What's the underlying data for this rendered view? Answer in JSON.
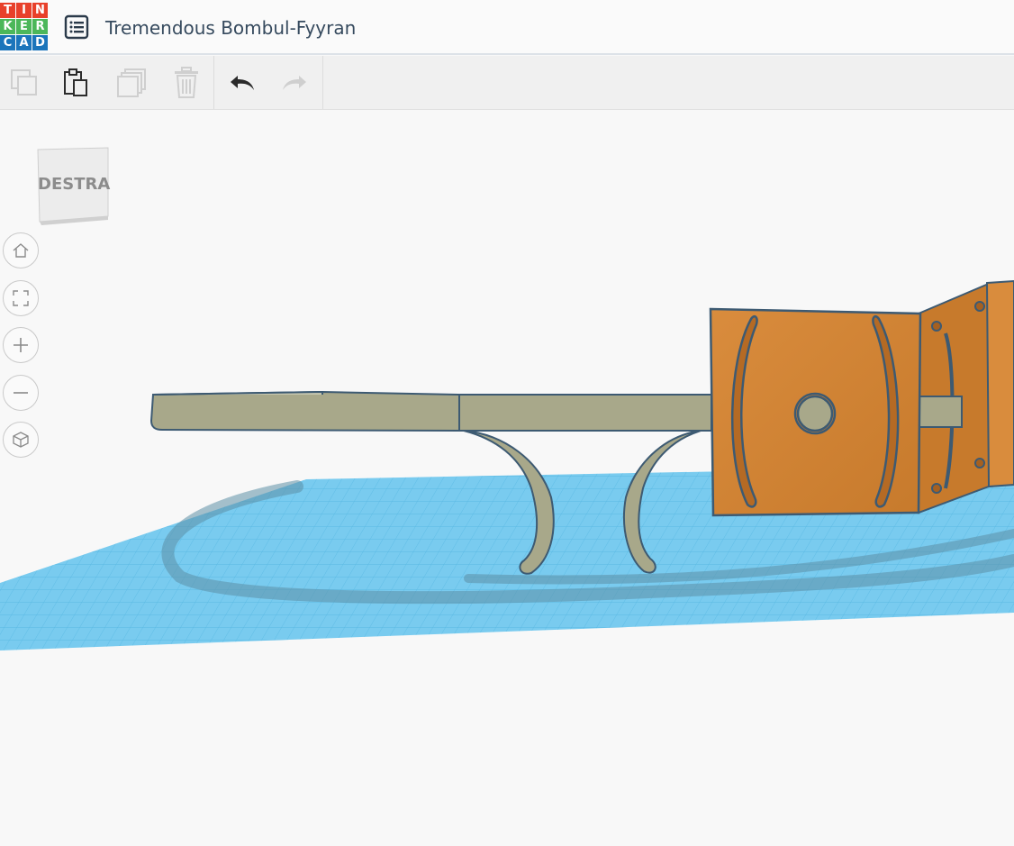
{
  "app": {
    "logo_letters": [
      "T",
      "I",
      "N",
      "K",
      "E",
      "R",
      "C",
      "A",
      "D"
    ],
    "logo_colors": [
      "#e8402a",
      "#e8402a",
      "#e8402a",
      "#4cb75a",
      "#4cb75a",
      "#4cb75a",
      "#1b75bb",
      "#1b75bb",
      "#1b75bb"
    ],
    "design_title": "Tremendous Bombul-Fyyran"
  },
  "toolbar": {
    "items": [
      {
        "icon": "copy-icon",
        "enabled": false
      },
      {
        "icon": "paste-icon",
        "enabled": true
      },
      {
        "icon": "duplicate-icon",
        "enabled": false
      },
      {
        "icon": "delete-icon",
        "enabled": false
      },
      {
        "icon": "undo-icon",
        "enabled": true
      },
      {
        "icon": "redo-icon",
        "enabled": false
      }
    ]
  },
  "viewcube": {
    "label": "DESTRA"
  },
  "nav_controls": [
    {
      "icon": "home-view-icon"
    },
    {
      "icon": "fit-view-icon"
    },
    {
      "icon": "zoom-in-icon"
    },
    {
      "icon": "zoom-out-icon"
    },
    {
      "icon": "perspective-icon"
    }
  ],
  "colors": {
    "workplane": "#6ec8ef",
    "shape_gray": "#a5a587",
    "shape_orange": "#d2873a",
    "outline": "#3d5a72"
  }
}
